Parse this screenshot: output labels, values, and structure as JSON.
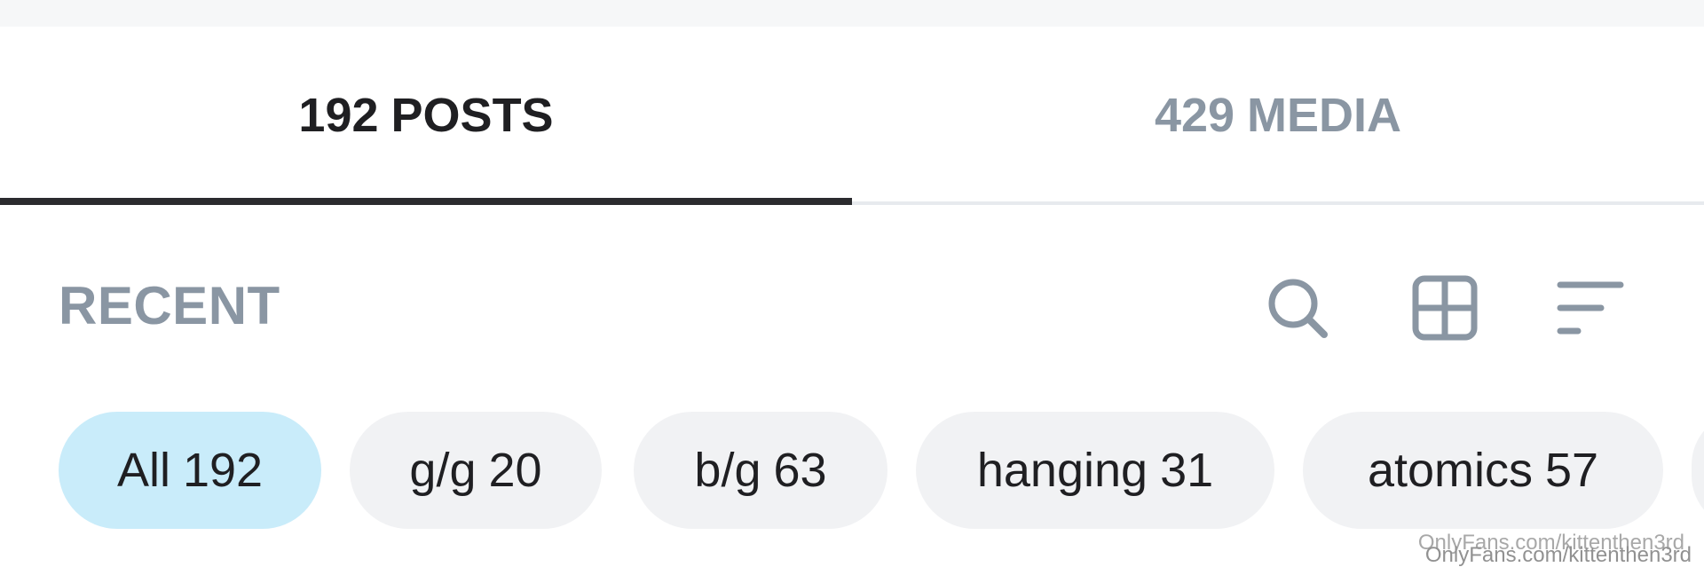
{
  "tabs": {
    "posts": {
      "count": "192",
      "label": "POSTS"
    },
    "media": {
      "count": "429",
      "label": "MEDIA"
    },
    "active": "posts"
  },
  "section": {
    "title": "RECENT"
  },
  "toolbar": {
    "icons": [
      "search-icon",
      "grid-icon",
      "sort-icon"
    ]
  },
  "filters": [
    {
      "label": "All",
      "count": "192",
      "active": true
    },
    {
      "label": "g/g",
      "count": "20",
      "active": false
    },
    {
      "label": "b/g",
      "count": "63",
      "active": false
    },
    {
      "label": "hanging",
      "count": "31",
      "active": false
    },
    {
      "label": "atomics",
      "count": "57",
      "active": false
    }
  ],
  "watermark": {
    "line1": "OnlyFans.com/kittenthen3rd",
    "line2": "OnlyFans.com/kittenthen3rd"
  },
  "colors": {
    "active_text": "#1f1f22",
    "inactive_text": "#8a96a3",
    "active_chip": "#c9ecfa",
    "chip_bg": "#f1f2f4",
    "tab_underline": "#2b2b2e"
  }
}
